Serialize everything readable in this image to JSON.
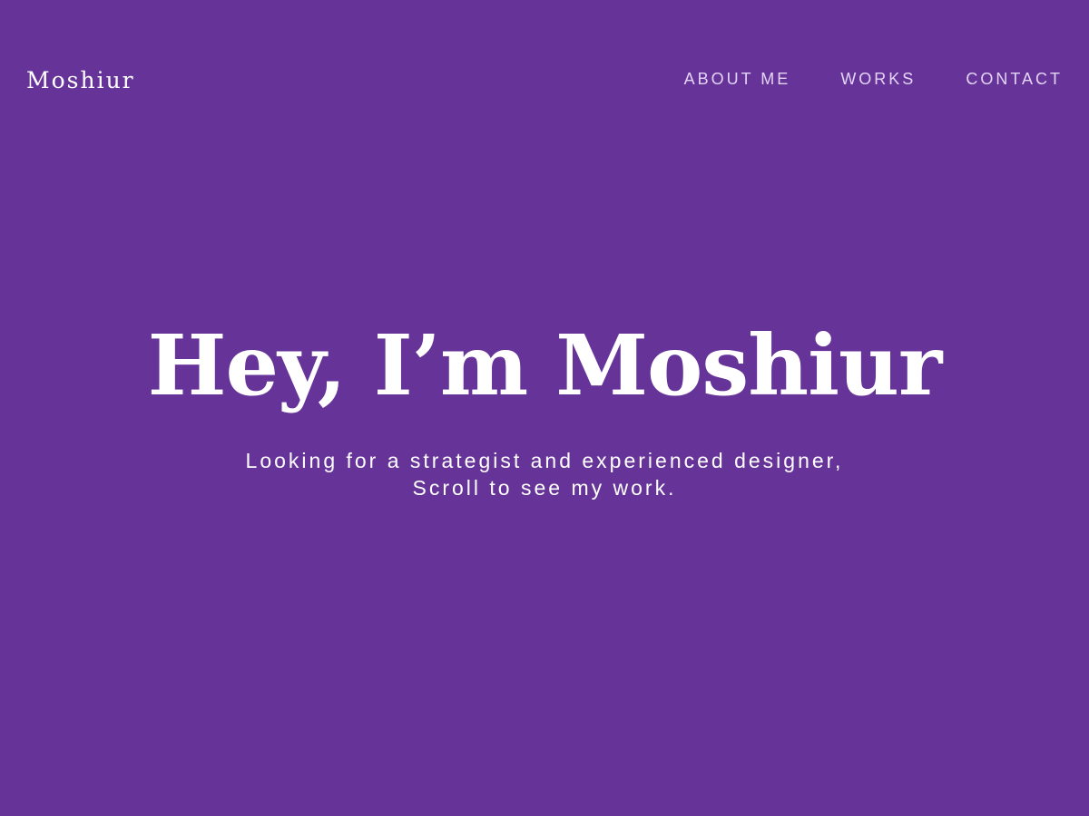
{
  "header": {
    "logo": "Moshiur",
    "nav": [
      {
        "label": "ABOUT ME"
      },
      {
        "label": "WORKS"
      },
      {
        "label": "CONTACT"
      }
    ]
  },
  "hero": {
    "title": "Hey, I’m Moshiur",
    "subtitle_line1": "Looking for a strategist and experienced designer,",
    "subtitle_line2": "Scroll to see my work."
  },
  "colors": {
    "background": "#663399",
    "text": "#ffffff",
    "nav_text": "#e4d4f6"
  }
}
